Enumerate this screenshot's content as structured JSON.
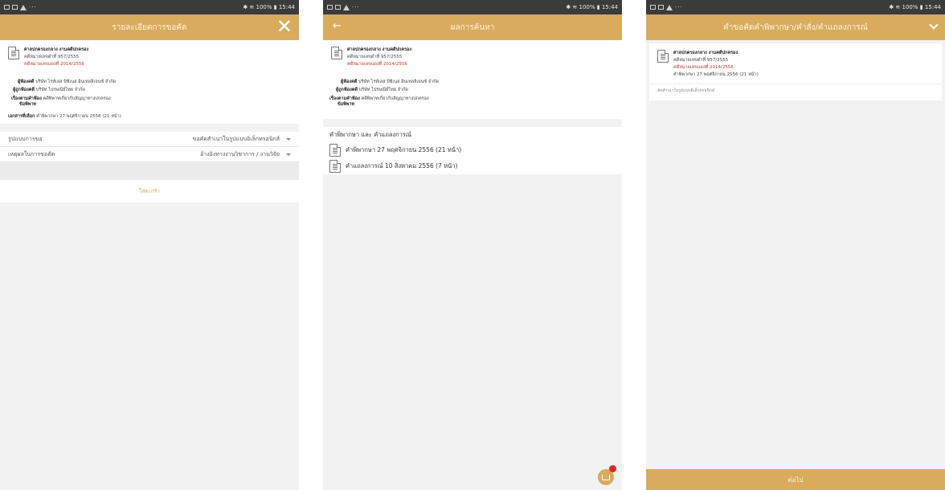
{
  "status_bar": {
    "right_text": "✱ ≋ 100% ▮ 15:44",
    "dots": "···"
  },
  "case": {
    "court": "ศาลปกครองกลาง งานคดีปกครอง",
    "black_case": "คดีหมายเลขดำที่ 957/2555",
    "red_case": "คดีหมายเลขแดงที่ 2014/2556"
  },
  "screen1": {
    "title": "รายละเอียดการขอคัด",
    "close_icon": "✕",
    "plaintiff_label": "ผู้ฟ้องคดี",
    "plaintiff_value": "บริษัท ไรท์เลส บิซิเนส อินเทลลิเจนซ์ จำกัด",
    "defendant_label": "ผู้ถูกฟ้องคดี",
    "defendant_value": "บริษัท ไปรษณีย์ไทย จำกัด",
    "subject_label": "เรื่องตามคำฟ้อง",
    "subject_value": "คดีพิพาทเกี่ยวกับสัญญาทางปกครอง",
    "subject_label2": "ข้อพิพาท",
    "selected_label": "เอกสารที่เลือก",
    "selected_value": "คำพิพากษา 27 พฤศจิกายน 2556 (21 หน้า)",
    "form_label_1": "รูปแบบการขอ",
    "form_value_1": "ขอคัดสำเนาในรูปแบบอิเล็กทรอนิกส์",
    "form_label_2": "เหตุผลในการขอคัด",
    "form_value_2": "อ้างอิงทางงานวิชาการ / งานวิจัย",
    "add_to_cart": "ใส่ตะกร้า"
  },
  "screen2": {
    "title": "ผลการค้นหา",
    "back_icon": "←",
    "plaintiff_label": "ผู้ฟ้องคดี",
    "plaintiff_value": "บริษัท ไรท์เลส บิซิเนส อินเทลลิเจนซ์ จำกัด",
    "defendant_label": "ผู้ถูกฟ้องคดี",
    "defendant_value": "บริษัท ไปรษณีย์ไทย จำกัด",
    "subject_label": "เรื่องตามคำฟ้อง",
    "subject_value": "คดีพิพาทเกี่ยวกับสัญญาทางปกครอง",
    "subject_label2": "ข้อพิพาท",
    "section_title": "คำพิพากษา และ คำแถลงการณ์",
    "docs": [
      "คำพิพากษา 27 พฤศจิกายน 2556 (21 หน้า)",
      "คำแถลงการณ์ 10 สิงหาคม 2556 (7 หน้า)"
    ]
  },
  "screen3": {
    "title": "คำขอคัดคำพิพากษา/คำสั่ง/คำแถลงการณ์",
    "doc_line": "คำพิพากษา 27 พฤศจิกายน 2556 (21 หน้า)",
    "sub_link": "คัดสำเนาในรูปแบบอิเล็กทรอนิกส์",
    "next_button": "ต่อไป"
  }
}
